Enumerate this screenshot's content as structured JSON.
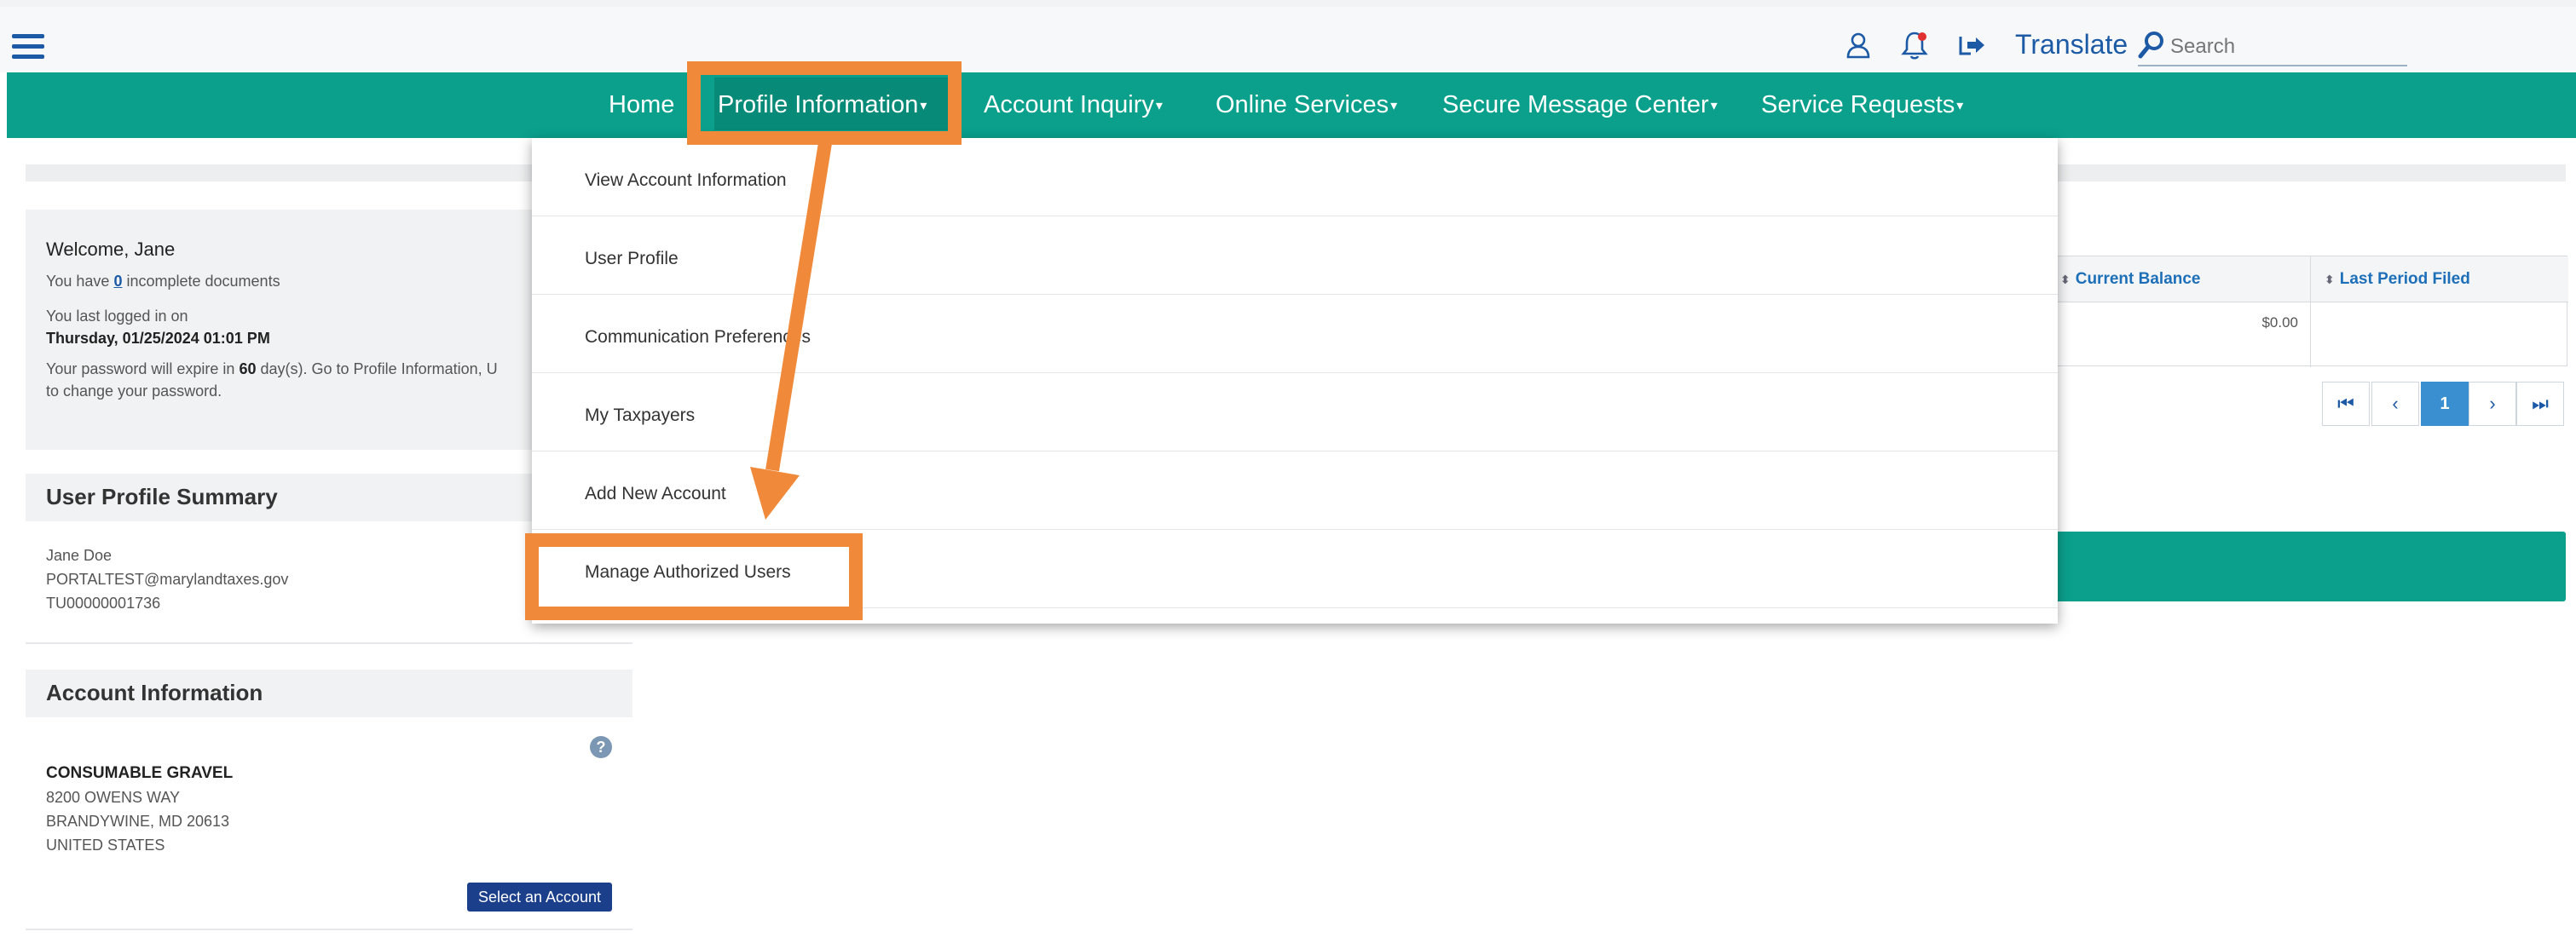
{
  "header": {
    "translate_label": "Translate",
    "search_placeholder": "Search"
  },
  "nav": {
    "items": [
      {
        "label": "Home"
      },
      {
        "label": "Profile Information"
      },
      {
        "label": "Account Inquiry"
      },
      {
        "label": "Online Services"
      },
      {
        "label": "Secure Message Center"
      },
      {
        "label": "Service Requests"
      }
    ]
  },
  "dropdown": {
    "items": [
      {
        "label": "View Account Information"
      },
      {
        "label": "User Profile"
      },
      {
        "label": "Communication Preferences"
      },
      {
        "label": "My Taxpayers"
      },
      {
        "label": "Add New Account"
      },
      {
        "label": "Manage Authorized Users"
      }
    ]
  },
  "welcome": {
    "title": "Welcome, Jane",
    "incomplete_prefix": "You have",
    "incomplete_count": "0",
    "incomplete_suffix": "incomplete documents",
    "last_login_label": "You last logged in on",
    "last_login_value": "Thursday, 01/25/2024 01:01 PM",
    "pw_prefix": "Your password will expire in",
    "pw_days": "60",
    "pw_suffix": "day(s). Go to Profile Information, U",
    "pw_line2": "to change your password."
  },
  "user_profile": {
    "heading": "User Profile Summary",
    "name": "Jane Doe",
    "email": "PORTALTEST@marylandtaxes.gov",
    "id": "TU00000001736"
  },
  "account_info": {
    "heading": "Account Information",
    "company": "CONSUMABLE GRAVEL",
    "address1": "8200 OWENS WAY",
    "address2": "BRANDYWINE, MD 20613",
    "country": "UNITED STATES",
    "help_icon": "?",
    "select_button": "Select an Account"
  },
  "table": {
    "columns": [
      "Current Balance",
      "Last Period Filed"
    ],
    "rows": [
      [
        "$0.00",
        ""
      ]
    ],
    "pager": {
      "current": "1"
    }
  },
  "colors": {
    "nav_teal": "#0aa08c",
    "annotation_orange": "#f08a3a",
    "link_blue": "#1d5aa6",
    "button_navy": "#1b3f8b"
  }
}
